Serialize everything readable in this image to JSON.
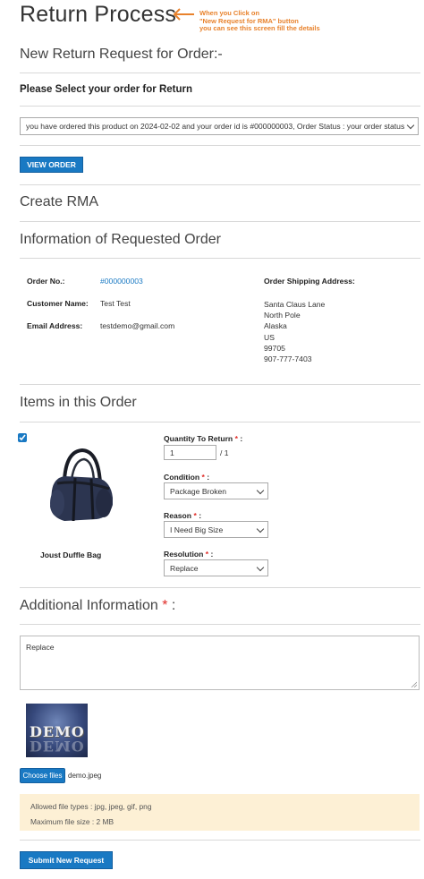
{
  "page": {
    "title": "Return Process",
    "annotation": "When you Click on\n\"New Request for RMA\" button\nyou can see this screen fill the details"
  },
  "order_select": {
    "heading": "New Return Request for Order:-",
    "label": "Please Select your order for Return",
    "selected_value": "you have ordered this product on 2024-02-02 and your order id is #000000003, Order Status : your order status",
    "view_order_button": "VIEW ORDER"
  },
  "rma": {
    "heading": "Create RMA"
  },
  "order_info": {
    "heading": "Information of Requested Order",
    "order_no_label": "Order No.:",
    "order_no_value": "#000000003",
    "customer_name_label": "Customer Name:",
    "customer_name_value": "Test Test",
    "email_label": "Email Address:",
    "email_value": "testdemo@gmail.com",
    "shipping_label": "Order Shipping Address:",
    "shipping_lines": [
      "Santa Claus Lane",
      "North Pole",
      "Alaska",
      "US",
      "99705",
      "907-777-7403"
    ]
  },
  "items": {
    "heading": "Items in this Order",
    "checked": true,
    "product_name": "Joust Duffle Bag",
    "quantity_label": "Quantity To Return",
    "required_mark": "*",
    "colon": ":",
    "quantity_value": "1",
    "quantity_max": "/ 1",
    "condition_label": "Condition",
    "condition_value": "Package Broken",
    "reason_label": "Reason",
    "reason_value": "I Need Big Size",
    "resolution_label": "Resolution",
    "resolution_value": "Replace"
  },
  "additional": {
    "heading": "Additional Information",
    "required_mark": "*",
    "colon": ":",
    "text": "Replace",
    "demo_image_text": "DEMO",
    "choose_files_button": "Choose files",
    "file_name": "demo.jpeg",
    "allowed_types": "Allowed file types : jpg, jpeg, gif, png",
    "max_size": "Maximum file size : 2 MB"
  },
  "submit_button": "Submit New Request",
  "colors": {
    "primary_blue": "#1979c3",
    "annotation_orange": "#e8822c",
    "required_red": "#e02b27",
    "notice_bg": "#fdf0d5"
  }
}
